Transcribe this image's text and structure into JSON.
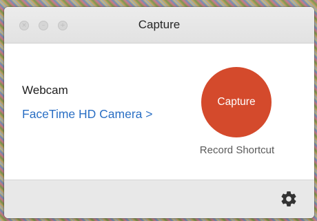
{
  "window": {
    "title": "Capture"
  },
  "titlebar": {
    "buttons": [
      {
        "icon": "close-icon"
      },
      {
        "icon": "minimize-icon"
      },
      {
        "icon": "zoom-icon"
      }
    ]
  },
  "webcam": {
    "label": "Webcam",
    "camera_link": "FaceTime HD Camera >"
  },
  "capture": {
    "button_label": "Capture",
    "button_color": "#d44a2c",
    "shortcut_label": "Record Shortcut"
  },
  "footer": {
    "settings_icon": "gear-icon"
  },
  "colors": {
    "link": "#2a6fc4",
    "titlebar": "#e6e6e6",
    "footer": "#e8e8e8"
  }
}
